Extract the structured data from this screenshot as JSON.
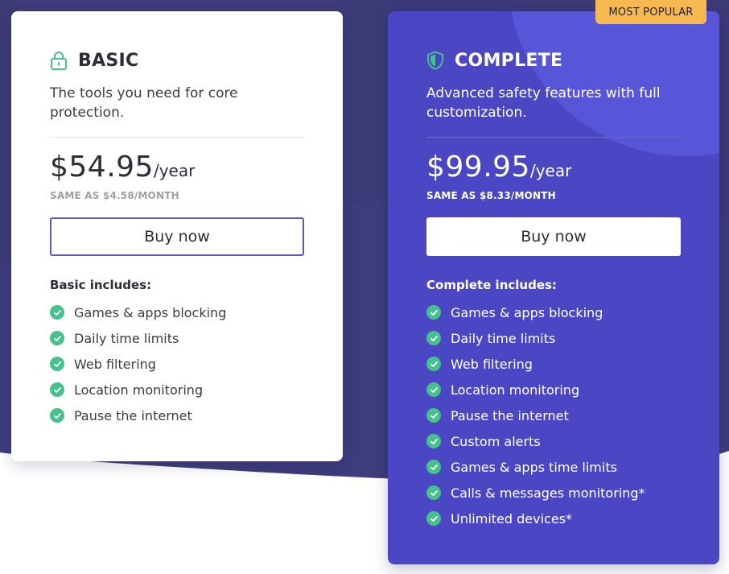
{
  "colors": {
    "background_dark": "#3d3a78",
    "complete_card": "#4b47c4",
    "badge": "#f6b94f",
    "check": "#46c08c",
    "button_border": "#5b58c2"
  },
  "basic": {
    "icon": "lock-icon",
    "name": "BASIC",
    "description": "The tools you need for core protection.",
    "price": "$54.95",
    "period": "/year",
    "same_as": "SAME AS $4.58/MONTH",
    "buy_label": "Buy now",
    "includes_label": "Basic includes:",
    "features": [
      "Games & apps blocking",
      "Daily time limits",
      "Web filtering",
      "Location monitoring",
      "Pause the internet"
    ]
  },
  "complete": {
    "badge": "MOST POPULAR",
    "icon": "shield-icon",
    "name": "COMPLETE",
    "description": "Advanced safety features with full customization.",
    "price": "$99.95",
    "period": "/year",
    "same_as": "SAME AS $8.33/MONTH",
    "buy_label": "Buy now",
    "includes_label": "Complete includes:",
    "features": [
      "Games & apps blocking",
      "Daily time limits",
      "Web filtering",
      "Location monitoring",
      "Pause the internet",
      "Custom alerts",
      "Games & apps time limits",
      "Calls & messages monitoring*",
      "Unlimited devices*"
    ]
  }
}
